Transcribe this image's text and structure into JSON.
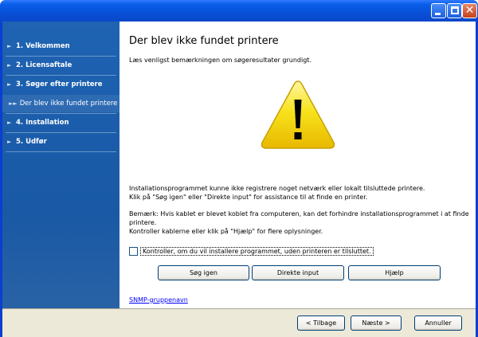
{
  "window": {
    "controls": {
      "minimize_icon": "minimize-icon",
      "maximize_icon": "maximize-icon",
      "close_symbol": "✕"
    }
  },
  "sidebar": {
    "items": [
      {
        "label": "1. Velkommen",
        "icon": "arrow-icon"
      },
      {
        "label": "2. Licensaftale",
        "icon": "arrow-icon"
      },
      {
        "label": "3. Søger efter printere",
        "icon": "arrow-icon"
      },
      {
        "label": "Der blev ikke fundet printere",
        "icon": "double-arrow-icon",
        "active": true
      },
      {
        "label": "4. Installation",
        "icon": "arrow-icon"
      },
      {
        "label": "5. Udfør",
        "icon": "arrow-icon"
      }
    ]
  },
  "main": {
    "heading": "Der blev ikke fundet printere",
    "subtitle": "Læs venligst bemærkningen om søgeresultater grundigt.",
    "warning_icon": "warning-icon",
    "paragraph1_line1": "Installationsprogrammet kunne ikke registrere noget netværk eller lokalt tilsluttede printere.",
    "paragraph1_line2": "Klik på \"Søg igen\" eller \"Direkte input\" for assistance til at finde en printer.",
    "paragraph2_line1": "Bemærk: Hvis kablet er blevet koblet fra computeren, kan det forhindre installationsprogrammet i at finde printere.",
    "paragraph2_line2": "Kontroller kablerne eller klik på \"Hjælp\" for flere oplysninger.",
    "checkbox_label": "Kontroller, om du vil installere programmet, uden printeren er tilsluttet.",
    "checkbox_checked": false,
    "buttons": {
      "search_again": "Søg igen",
      "direct_input": "Direkte input",
      "help": "Hjælp"
    },
    "link": "SNMP-gruppenavn"
  },
  "footer": {
    "back": "< Tilbage",
    "next": "Næste >",
    "cancel": "Annuller"
  },
  "colors": {
    "sidebar": "#1a5ba8",
    "title_bar": "#0a5ee8",
    "footer": "#ece9d8",
    "warning_fill": "#f5d90a"
  }
}
